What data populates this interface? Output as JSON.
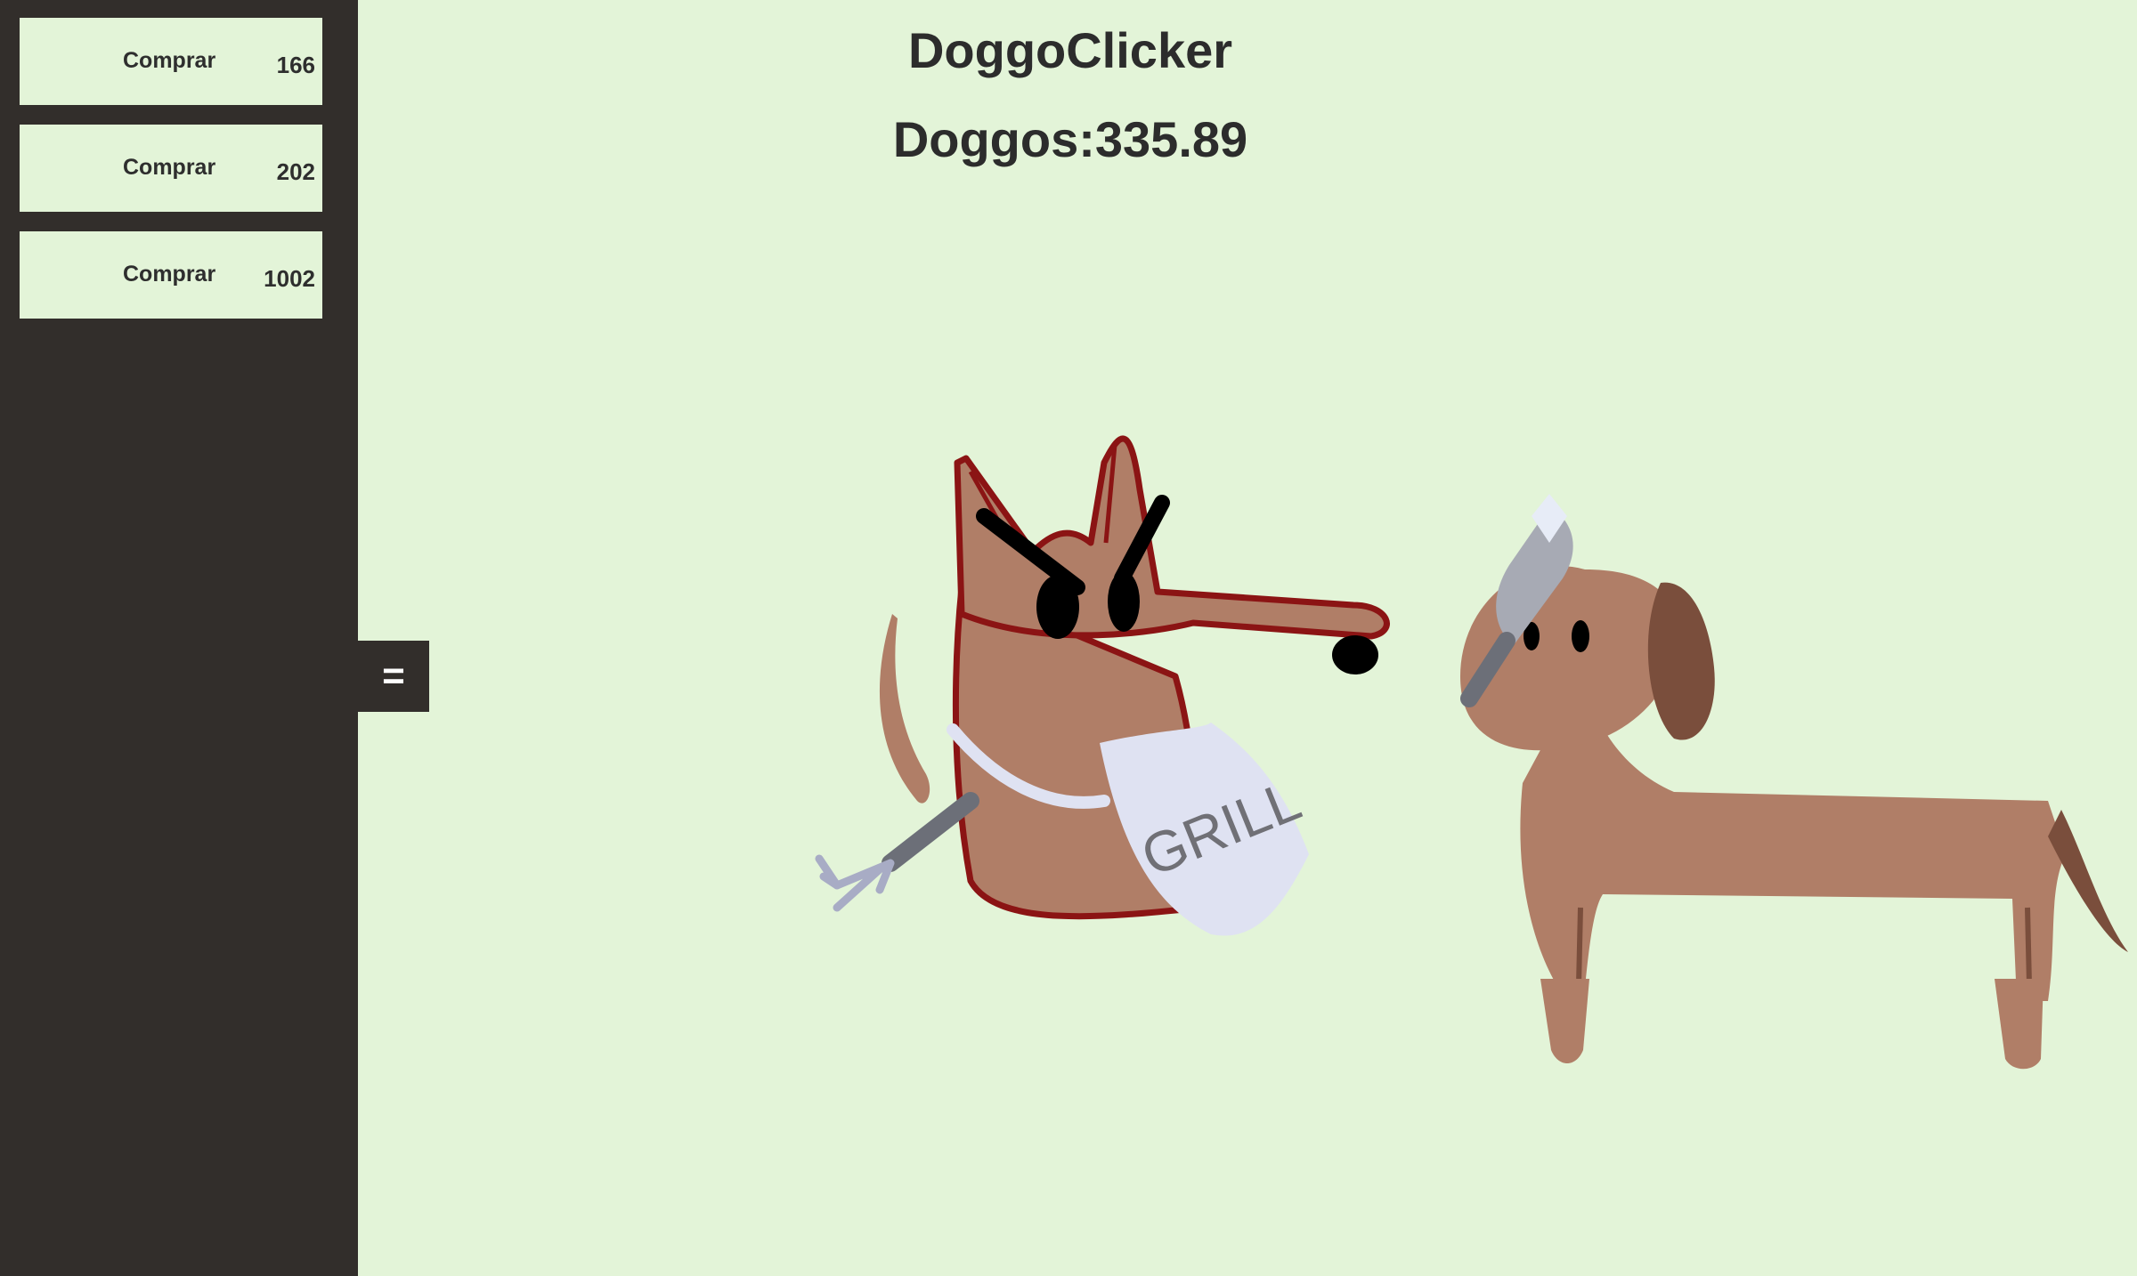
{
  "app": {
    "title": "DoggoClicker",
    "counter_label": "Doggos:",
    "counter_value": "335.89"
  },
  "shop": {
    "items": [
      {
        "label": "Comprar",
        "price": "166"
      },
      {
        "label": "Comprar",
        "price": "202"
      },
      {
        "label": "Comprar",
        "price": "1002"
      }
    ]
  },
  "sidebar": {
    "toggle_label": "="
  },
  "scene": {
    "bib_text": "GRILL"
  },
  "colors": {
    "background": "#e3f4d8",
    "sidebar": "#322e2b",
    "dog_fur": "#b07e67",
    "dog_ear": "#7a4e3c",
    "dog_outline": "#8b1414",
    "bib": "#dfe2f2",
    "utensil": "#8f93a1"
  }
}
